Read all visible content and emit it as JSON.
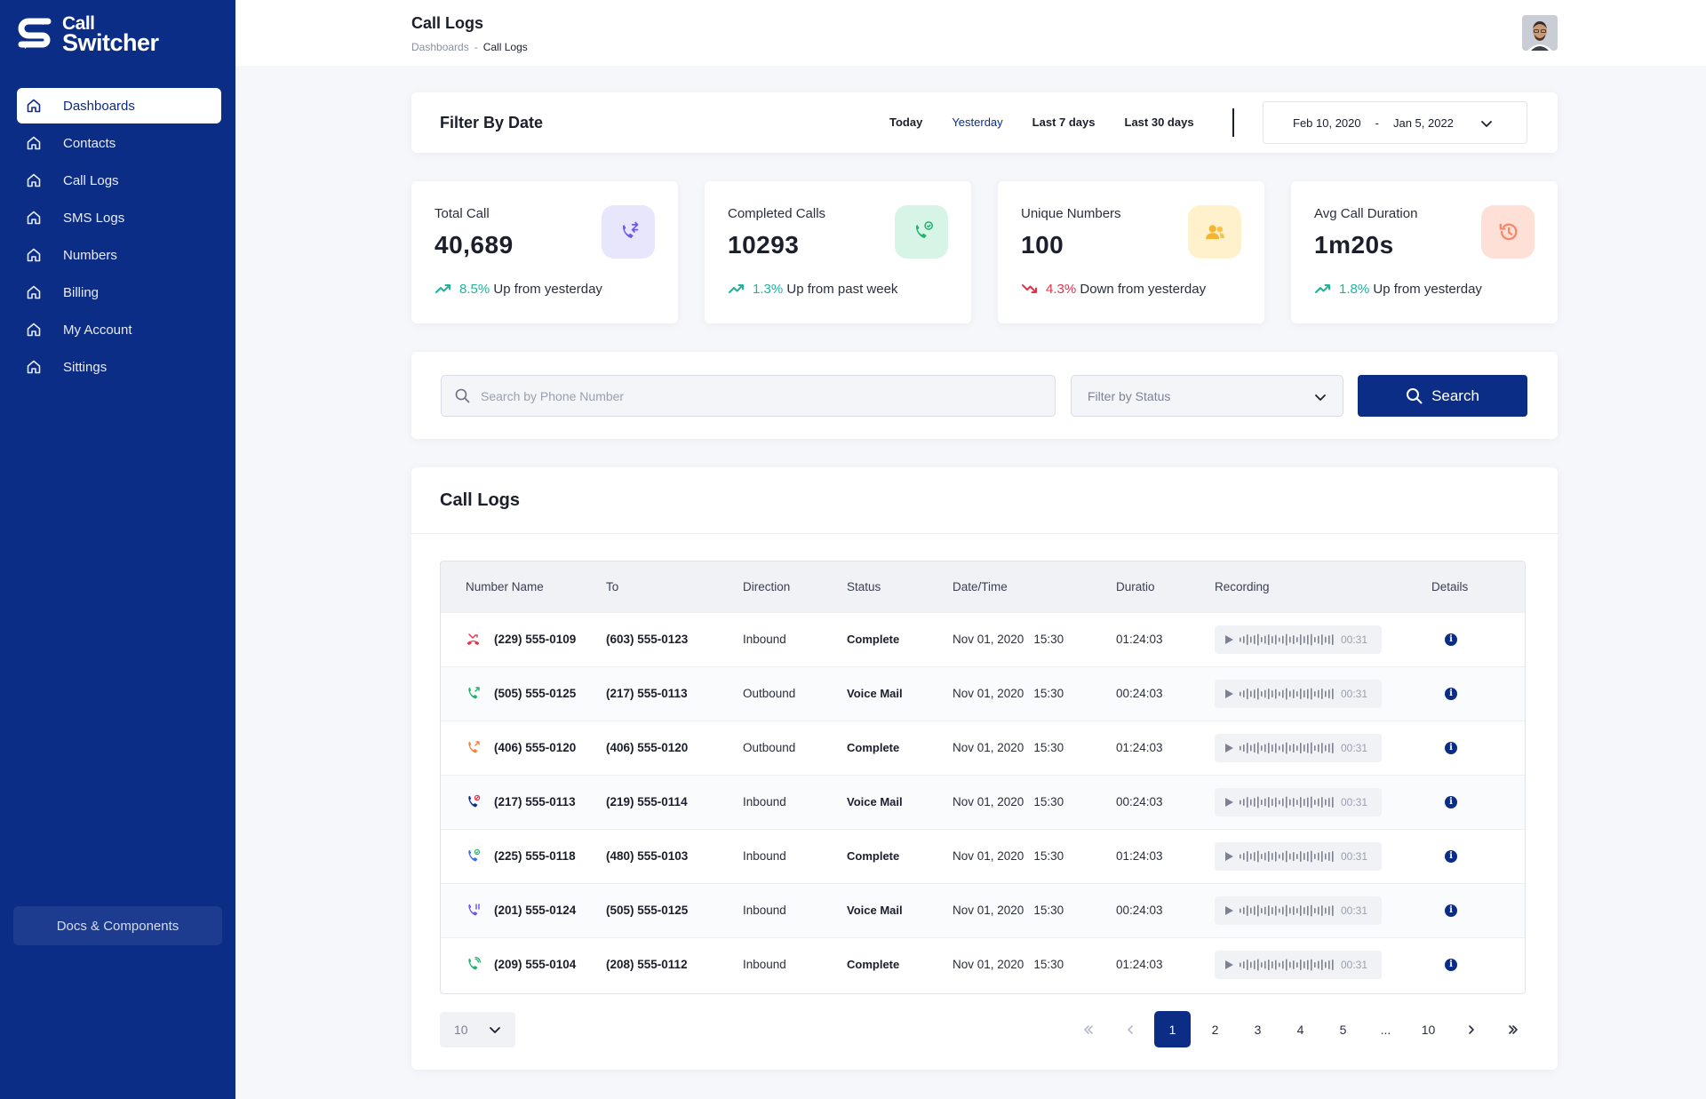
{
  "app": {
    "logo_line1": "Call",
    "logo_line2": "Switcher"
  },
  "sidebar": {
    "items": [
      {
        "label": "Dashboards",
        "icon": "home-icon",
        "active": true
      },
      {
        "label": "Contacts",
        "icon": "home-icon"
      },
      {
        "label": "Call Logs",
        "icon": "home-icon"
      },
      {
        "label": "SMS Logs",
        "icon": "home-icon"
      },
      {
        "label": "Numbers",
        "icon": "home-icon"
      },
      {
        "label": "Billing",
        "icon": "home-icon"
      },
      {
        "label": "My Account",
        "icon": "home-icon"
      },
      {
        "label": "Sittings",
        "icon": "home-icon"
      }
    ],
    "docs_label": "Docs & Components"
  },
  "header": {
    "title": "Call Logs",
    "breadcrumb": [
      "Dashboards",
      "-",
      "Call Logs"
    ]
  },
  "filter": {
    "title": "Filter By Date",
    "ranges": [
      "Today",
      "Yesterday",
      "Last 7 days",
      "Last 30 days"
    ],
    "selected_range": "Yesterday",
    "date_from": "Feb 10, 2020",
    "date_sep": "-",
    "date_to": "Jan 5, 2022"
  },
  "stats": [
    {
      "label": "Total Call",
      "value": "40,689",
      "change": "8.5%",
      "trend": "up",
      "note": "Up from yesterday",
      "icon": "phone-transfer-icon",
      "icon_bg": "#e8e6fd",
      "icon_color": "#6b5ce7"
    },
    {
      "label": "Completed Calls",
      "value": "10293",
      "change": "1.3%",
      "trend": "up",
      "note": "Up from past week",
      "icon": "phone-check-icon",
      "icon_bg": "#d7f5e6",
      "icon_color": "#1fb36e"
    },
    {
      "label": "Unique Numbers",
      "value": "100",
      "change": "4.3%",
      "trend": "down",
      "note": "Down from yesterday",
      "icon": "users-icon",
      "icon_bg": "#fff1cc",
      "icon_color": "#f6b52e"
    },
    {
      "label": "Avg Call Duration",
      "value": "1m20s",
      "change": "1.8%",
      "trend": "up",
      "note": "Up from yesterday",
      "icon": "history-clock-icon",
      "icon_bg": "#ffe0d6",
      "icon_color": "#f8886a"
    }
  ],
  "search": {
    "placeholder": "Search by Phone Number",
    "status_placeholder": "Filter by Status",
    "button_label": "Search"
  },
  "logs": {
    "title": "Call Logs",
    "columns": [
      "Number Name",
      "To",
      "Direction",
      "Status",
      "Date/Time",
      "Duratio",
      "Recording",
      "Details"
    ],
    "rows": [
      {
        "icon": "missed-call-icon",
        "icon_color": "#e2324a",
        "from": "(229) 555-0109",
        "to": "(603) 555-0123",
        "direction": "Inbound",
        "status": "Complete",
        "date": "Nov 01, 2020",
        "time": "15:30",
        "duration": "01:24:03",
        "rec_time": "00:31"
      },
      {
        "icon": "outgoing-call-icon",
        "icon_color": "#1fb36e",
        "from": "(505) 555-0125",
        "to": "(217) 555-0113",
        "direction": "Outbound",
        "status": "Voice Mail",
        "date": "Nov 01, 2020",
        "time": "15:30",
        "duration": "00:24:03",
        "rec_time": "00:31"
      },
      {
        "icon": "outgoing-call-icon",
        "icon_color": "#f2833a",
        "from": "(406) 555-0120",
        "to": "(406) 555-0120",
        "direction": "Outbound",
        "status": "Complete",
        "date": "Nov 01, 2020",
        "time": "15:30",
        "duration": "01:24:03",
        "rec_time": "00:31"
      },
      {
        "icon": "phone-blocked-icon",
        "icon_color": "#0b2d86",
        "from": "(217) 555-0113",
        "to": "(219) 555-0114",
        "direction": "Inbound",
        "status": "Voice Mail",
        "date": "Nov 01, 2020",
        "time": "15:30",
        "duration": "00:24:03",
        "rec_time": "00:31"
      },
      {
        "icon": "phone-check-icon",
        "icon_color": "#3a6df0",
        "from": "(225) 555-0118",
        "to": "(480) 555-0103",
        "direction": "Inbound",
        "status": "Complete",
        "date": "Nov 01, 2020",
        "time": "15:30",
        "duration": "01:24:03",
        "rec_time": "00:31"
      },
      {
        "icon": "phone-paused-icon",
        "icon_color": "#6b5ce7",
        "from": "(201) 555-0124",
        "to": "(505) 555-0125",
        "direction": "Inbound",
        "status": "Voice Mail",
        "date": "Nov 01, 2020",
        "time": "15:30",
        "duration": "00:24:03",
        "rec_time": "00:31"
      },
      {
        "icon": "phone-ringing-icon",
        "icon_color": "#1fb36e",
        "from": "(209) 555-0104",
        "to": "(208) 555-0112",
        "direction": "Inbound",
        "status": "Complete",
        "date": "Nov 01, 2020",
        "time": "15:30",
        "duration": "01:24:03",
        "rec_time": "00:31"
      }
    ]
  },
  "pagination": {
    "per_page": "10",
    "pages": [
      "1",
      "2",
      "3",
      "4",
      "5",
      "...",
      "10"
    ],
    "current": "1"
  },
  "colors": {
    "brand": "#0b2d86",
    "up": "#1bb49a",
    "down": "#e2324a"
  }
}
